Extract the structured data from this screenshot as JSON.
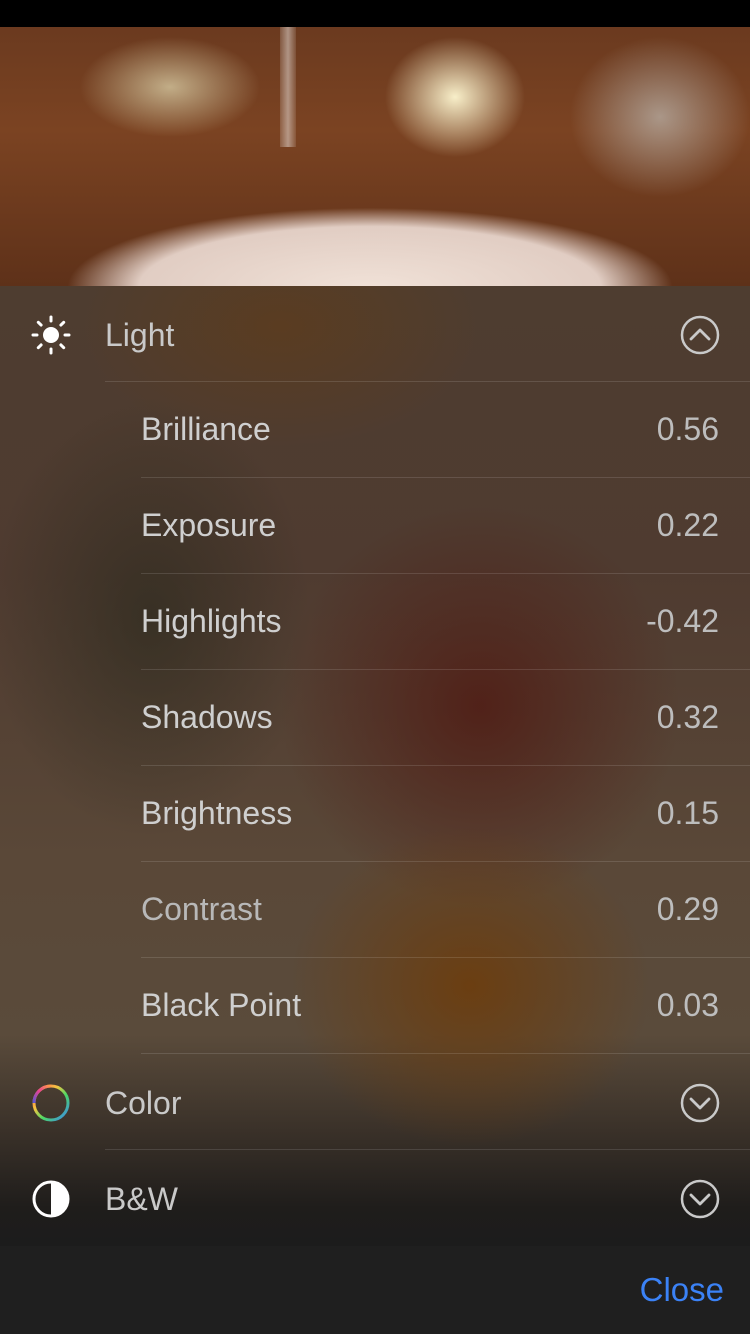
{
  "adjust_panel": {
    "light": {
      "label": "Light",
      "icon": "sun-icon",
      "expanded": true,
      "items": [
        {
          "label": "Brilliance",
          "value": "0.56"
        },
        {
          "label": "Exposure",
          "value": "0.22"
        },
        {
          "label": "Highlights",
          "value": "-0.42"
        },
        {
          "label": "Shadows",
          "value": "0.32"
        },
        {
          "label": "Brightness",
          "value": "0.15"
        },
        {
          "label": "Contrast",
          "value": "0.29"
        },
        {
          "label": "Black Point",
          "value": "0.03"
        }
      ]
    },
    "color": {
      "label": "Color",
      "icon": "color-wheel-icon",
      "expanded": false
    },
    "bw": {
      "label": "B&W",
      "icon": "half-circle-icon",
      "expanded": false
    }
  },
  "footer": {
    "close_label": "Close",
    "accent_color": "#3b82f6"
  }
}
